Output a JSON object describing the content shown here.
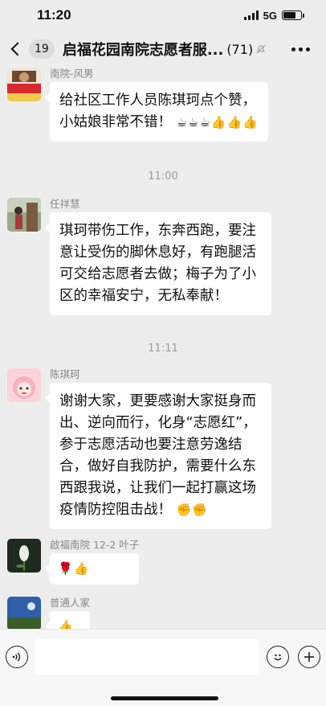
{
  "status_bar": {
    "time": "11:20",
    "network": "5G"
  },
  "nav": {
    "unread_count": "19",
    "title": "启福花园南院志愿者服...",
    "member_count": "(71)"
  },
  "messages": [
    {
      "sender": "南院-风男",
      "text": "给社区工作人员陈琪珂点个赞，小姑娘非常不错！",
      "emoji": "☕☕☕👍👍👍"
    },
    {
      "sender": "任祥慧",
      "text": "琪珂带伤工作，东奔西跑，要注意让受伤的脚休息好，有跑腿活可交给志愿者去做；梅子为了小区的幸福安宁，无私奉献！"
    },
    {
      "sender": "陈琪珂",
      "text": "谢谢大家，更要感谢大家挺身而出、逆向而行，化身“志愿红”，参于志愿活动也要注意劳逸结合，做好自我防护，需要什么东西跟我说，让我们一起打赢这场疫情防控阻击战！",
      "emoji": "✊✊"
    },
    {
      "sender": "啟福南院 12-2 叶子",
      "emoji": "🌹👍"
    },
    {
      "sender": "普通人家",
      "emoji": "👍"
    }
  ],
  "timestamps": [
    "11:00",
    "11:11"
  ],
  "input_bar": {
    "placeholder": ""
  }
}
